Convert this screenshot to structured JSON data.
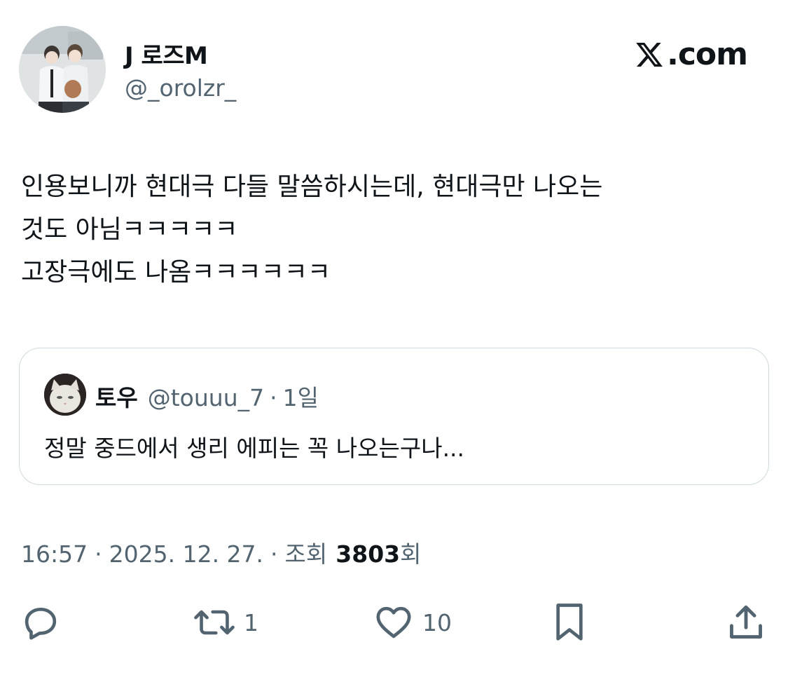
{
  "author": {
    "display_name": "J 로즈M",
    "handle": "@_orolzr_"
  },
  "brand": {
    "logo_text": ".com",
    "icon": "x-logo-icon"
  },
  "tweet": {
    "lines": [
      "인용보니까 현대극 다들 말씀하시는데, 현대극만 나오는",
      "것도 아님ㅋㅋㅋㅋㅋ",
      "고장극에도 나옴ㅋㅋㅋㅋㅋㅋ"
    ]
  },
  "quote": {
    "display_name": "토우",
    "handle": "@touuu_7",
    "separator": "·",
    "time": "1일",
    "text": "정말 중드에서 생리 에피는 꼭 나오는구나..."
  },
  "meta": {
    "time": "16:57",
    "separator": "·",
    "date": "2025. 12. 27.",
    "views_label": "조회",
    "views_count": "3803",
    "views_suffix": "회"
  },
  "actions": {
    "reply": {
      "icon": "reply-icon",
      "count": ""
    },
    "retweet": {
      "icon": "retweet-icon",
      "count": "1"
    },
    "like": {
      "icon": "heart-icon",
      "count": "10"
    },
    "bookmark": {
      "icon": "bookmark-icon",
      "count": ""
    },
    "share": {
      "icon": "share-icon",
      "count": ""
    }
  },
  "colors": {
    "text": "#0f1419",
    "secondary": "#536471",
    "border": "#cfd9de"
  }
}
